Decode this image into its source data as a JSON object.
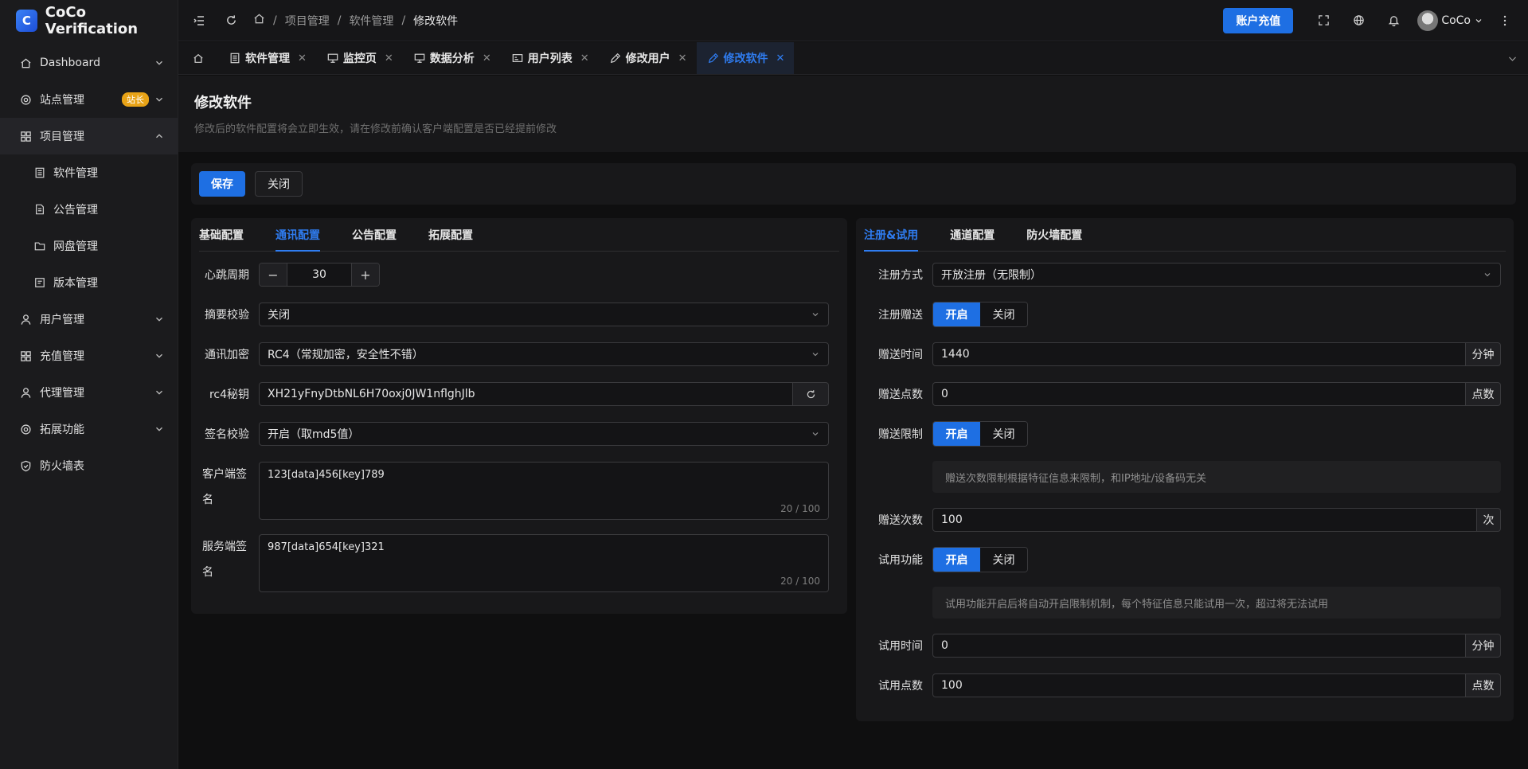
{
  "app": {
    "title": "CoCo Verification",
    "logo_letter": "C"
  },
  "sidebar": {
    "items": [
      {
        "label": "Dashboard"
      },
      {
        "label": "站点管理",
        "badge": "站长"
      },
      {
        "label": "项目管理"
      },
      {
        "label": "用户管理"
      },
      {
        "label": "充值管理"
      },
      {
        "label": "代理管理"
      },
      {
        "label": "拓展功能"
      },
      {
        "label": "防火墙表"
      }
    ],
    "sub_items": [
      {
        "label": "软件管理"
      },
      {
        "label": "公告管理"
      },
      {
        "label": "网盘管理"
      },
      {
        "label": "版本管理"
      }
    ]
  },
  "header": {
    "breadcrumb": [
      "项目管理",
      "软件管理",
      "修改软件"
    ],
    "recharge_label": "账户充值",
    "user_name": "CoCo"
  },
  "tabs": [
    {
      "label": "软件管理"
    },
    {
      "label": "监控页"
    },
    {
      "label": "数据分析"
    },
    {
      "label": "用户列表"
    },
    {
      "label": "修改用户"
    },
    {
      "label": "修改软件"
    }
  ],
  "page": {
    "title": "修改软件",
    "description": "修改后的软件配置将会立即生效，请在修改前确认客户端配置是否已经提前修改"
  },
  "actions": {
    "save": "保存",
    "close": "关闭"
  },
  "left_card": {
    "tabs": [
      "基础配置",
      "通讯配置",
      "公告配置",
      "拓展配置"
    ],
    "fields": {
      "heartbeat": {
        "label": "心跳周期",
        "value": "30"
      },
      "digest": {
        "label": "摘要校验",
        "value": "关闭"
      },
      "encryption": {
        "label": "通讯加密",
        "value": "RC4（常规加密，安全性不错）"
      },
      "rc4key": {
        "label": "rc4秘钥",
        "value": "XH21yFnyDtbNL6H70oxj0JW1nflghJlb"
      },
      "signature": {
        "label": "签名校验",
        "value": "开启（取md5值）"
      },
      "client_sign": {
        "label1": "客户端签",
        "label2": "名",
        "value": "123[data]456[key]789",
        "count": "20 / 100"
      },
      "server_sign": {
        "label1": "服务端签",
        "label2": "名",
        "value": "987[data]654[key]321",
        "count": "20 / 100"
      }
    }
  },
  "right_card": {
    "tabs": [
      "注册&试用",
      "通道配置",
      "防火墙配置"
    ],
    "fields": {
      "reg_mode": {
        "label": "注册方式",
        "value": "开放注册（无限制）"
      },
      "reg_gift": {
        "label": "注册赠送",
        "on": "开启",
        "off": "关闭"
      },
      "gift_time": {
        "label": "赠送时间",
        "value": "1440",
        "unit": "分钟"
      },
      "gift_points": {
        "label": "赠送点数",
        "value": "0",
        "unit": "点数"
      },
      "gift_limit": {
        "label": "赠送限制",
        "on": "开启",
        "off": "关闭"
      },
      "gift_limit_note": "赠送次数限制根据特征信息来限制，和IP地址/设备码无关",
      "gift_count": {
        "label": "赠送次数",
        "value": "100",
        "unit": "次"
      },
      "trial": {
        "label": "试用功能",
        "on": "开启",
        "off": "关闭"
      },
      "trial_note": "试用功能开启后将自动开启限制机制，每个特征信息只能试用一次，超过将无法试用",
      "trial_time": {
        "label": "试用时间",
        "value": "0",
        "unit": "分钟"
      },
      "trial_points": {
        "label": "试用点数",
        "value": "100",
        "unit": "点数"
      }
    }
  }
}
